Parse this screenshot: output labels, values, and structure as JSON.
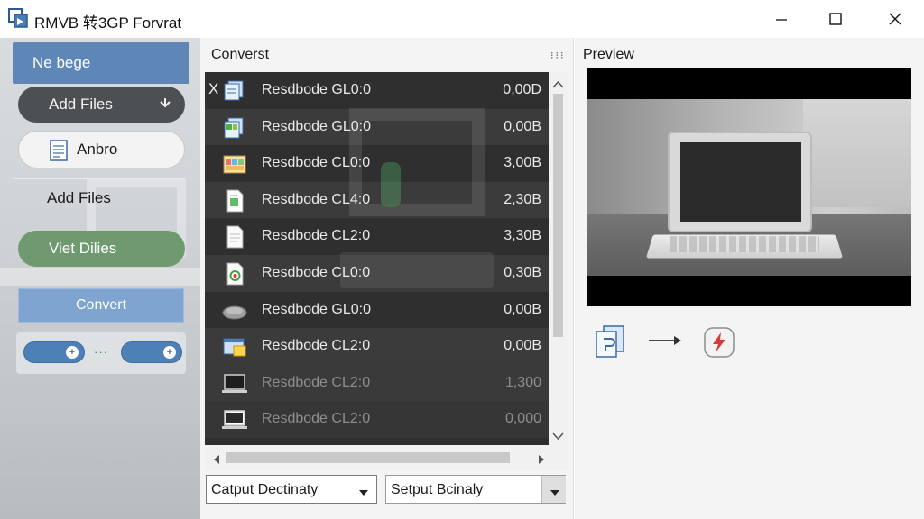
{
  "window": {
    "title": "RMVB 转3GP Forvrat",
    "icon": "app-logo-icon"
  },
  "sidebar": {
    "new_page": "Ne bege",
    "add_files_dropdown": "Add Files",
    "anbro": "Anbro",
    "add_files": "Add Files",
    "view_files": "Viet Dilies",
    "convert": "Convert",
    "pill_separator": "···"
  },
  "convert_panel": {
    "title": "Converst",
    "grip": "⁝⁝⁝",
    "close_glyph": "X",
    "files": [
      {
        "name": "Resdbode GL0:0",
        "size": "0,00D",
        "icon": "document-stack-icon"
      },
      {
        "name": "Resdbode GL0:0",
        "size": "0,00B",
        "icon": "spreadsheet-icon"
      },
      {
        "name": "Resdbode CL0:0",
        "size": "3,00B",
        "icon": "image-gallery-icon"
      },
      {
        "name": "Resdbode CL4:0",
        "size": "2,30B",
        "icon": "green-document-icon"
      },
      {
        "name": "Resdbode CL2:0",
        "size": "3,30B",
        "icon": "text-document-icon"
      },
      {
        "name": "Resdbode CL0:0",
        "size": "0,30B",
        "icon": "recycle-document-icon"
      },
      {
        "name": "Resdbode GL0:0",
        "size": "0,00B",
        "icon": "mouse-icon"
      },
      {
        "name": "Resdbode CL2:0",
        "size": "0,00B",
        "icon": "window-document-icon"
      },
      {
        "name": "Resdbode CL2:0",
        "size": "1,300",
        "icon": "laptop-icon"
      },
      {
        "name": "Resdbode CL2:0",
        "size": "0,000",
        "icon": "laptop-icon"
      }
    ],
    "output_destination": "Catput Dectinaty",
    "setup_binary": "Setput Bcinaly"
  },
  "preview": {
    "title": "Preview"
  },
  "colors": {
    "accent_blue": "#5e86b7",
    "view_green": "#6f9a6f",
    "convert_blue": "#7ea4cf",
    "list_bg": "#2f2f2f",
    "flash_red": "#d83a3a"
  }
}
